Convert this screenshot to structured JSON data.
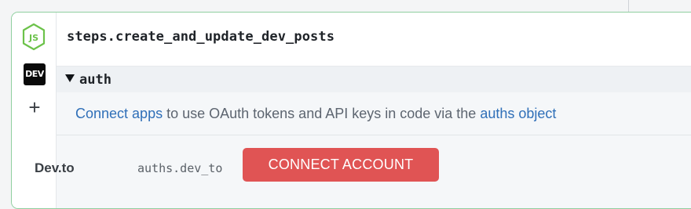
{
  "step": {
    "title": "steps.create_and_update_dev_posts"
  },
  "rail": {
    "icons": [
      "nodejs-icon",
      "dev-icon",
      "plus-icon"
    ],
    "dev_badge": "DEV",
    "add_glyph": "+"
  },
  "auth": {
    "section_label": "auth",
    "info": {
      "link1": "Connect apps",
      "middle": " to use OAuth tokens and API keys in code via the ",
      "link2": "auths object"
    },
    "account": {
      "app_name": "Dev.to",
      "auth_key": "auths.dev_to",
      "connect_label": "CONNECT ACCOUNT"
    }
  },
  "colors": {
    "accent_green": "#8fcf9f",
    "link_blue": "#2f6fb8",
    "connect_red": "#e05454"
  }
}
